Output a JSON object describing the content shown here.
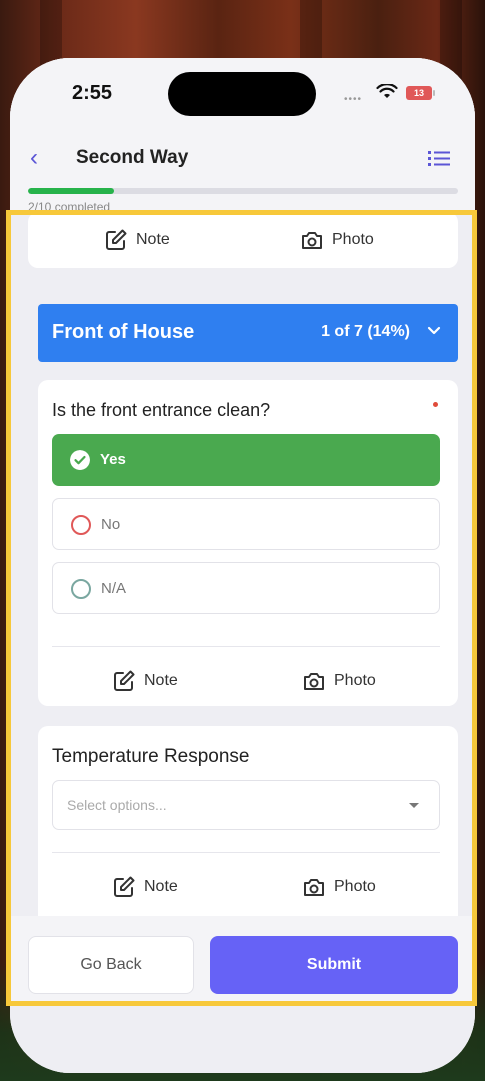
{
  "status": {
    "time": "2:55",
    "battery": "13"
  },
  "header": {
    "title": "Second Way"
  },
  "progress": {
    "label": "2/10 completed",
    "fraction": 0.2
  },
  "actions": {
    "note": "Note",
    "photo": "Photo"
  },
  "section": {
    "title": "Front of House",
    "count": "1 of 7 (14%)"
  },
  "question": {
    "text": "Is the front entrance clean?",
    "options": [
      {
        "label": "Yes",
        "selected": true
      },
      {
        "label": "No",
        "selected": false
      },
      {
        "label": "N/A",
        "selected": false
      }
    ]
  },
  "temperature": {
    "label": "Temperature Response",
    "placeholder": "Select options..."
  },
  "footer": {
    "back_label": "Go Back",
    "submit_label": "Submit"
  },
  "colors": {
    "accent": "#6662f6",
    "section": "#2f7ff0",
    "yes": "#4aa94f",
    "no": "#e05858",
    "na": "#7aa7a0",
    "highlight": "#f7c83a"
  }
}
